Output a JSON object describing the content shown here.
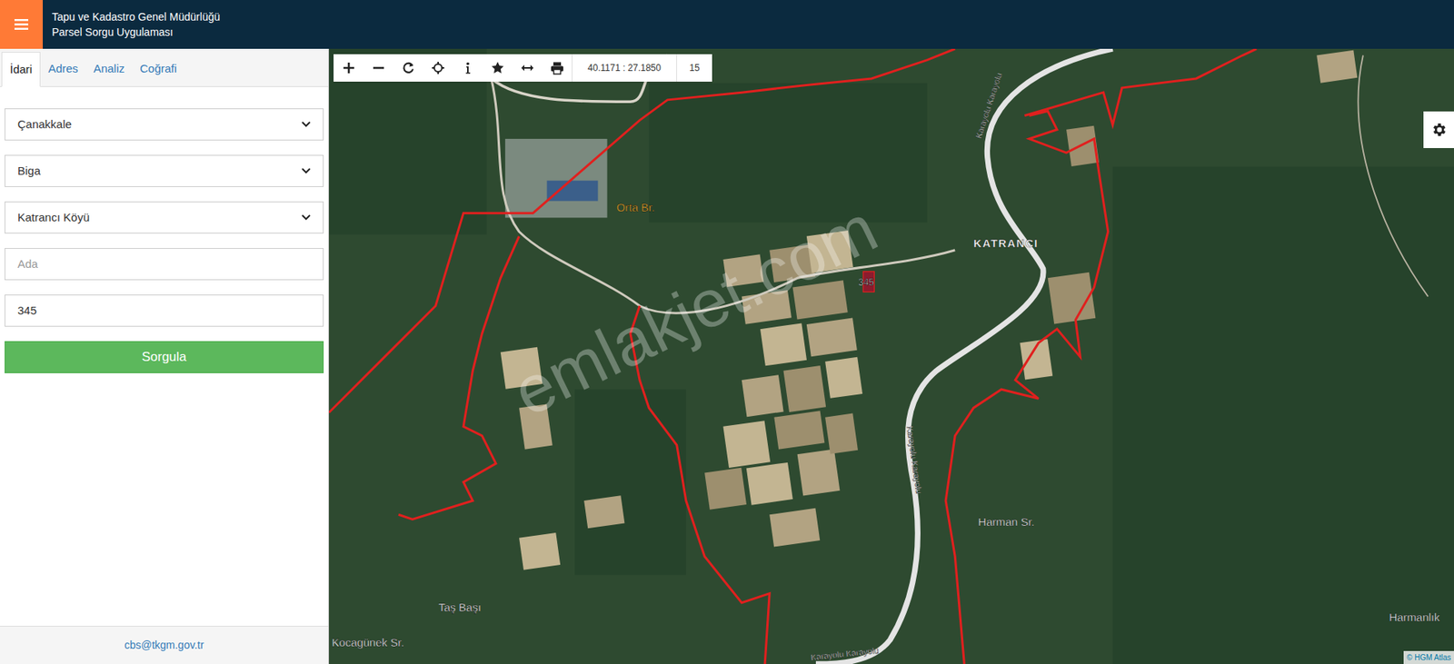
{
  "header": {
    "title_line1": "Tapu ve Kadastro Genel Müdürlüğü",
    "title_line2": "Parsel Sorgu Uygulaması"
  },
  "tabs": [
    {
      "label": "İdari",
      "selected": true
    },
    {
      "label": "Adres",
      "selected": false
    },
    {
      "label": "Analiz",
      "selected": false
    },
    {
      "label": "Coğrafi",
      "selected": false
    }
  ],
  "fields": [
    {
      "kind": "select",
      "value": "Çanakkale"
    },
    {
      "kind": "select",
      "value": "Biga"
    },
    {
      "kind": "select",
      "value": "Katrancı Köyü"
    },
    {
      "kind": "input",
      "placeholder": "Ada",
      "value": ""
    },
    {
      "kind": "input",
      "value": "345"
    }
  ],
  "query_button": "Sorgula",
  "footer": "cbs@tkgm.gov.tr",
  "toolbar": {
    "coordinates": "40.1171 : 27.1850",
    "zoom": "15"
  },
  "map": {
    "labels": [
      {
        "text": "Orta Br.",
        "kind": "place"
      },
      {
        "text": "KATRANCI",
        "kind": "village"
      },
      {
        "text": "Harman Sr.",
        "kind": "place"
      },
      {
        "text": "Taş Başı",
        "kind": "place"
      },
      {
        "text": "Kocagünek Sr.",
        "kind": "place"
      },
      {
        "text": "Harmanlık",
        "kind": "place"
      },
      {
        "text": "Karayolu Karayolu",
        "kind": "road"
      },
      {
        "text": "Karayolu Karayolu",
        "kind": "road"
      },
      {
        "text": "Karayolu Karayolu",
        "kind": "road"
      }
    ],
    "parcel_label": "345",
    "watermark": "emlakjet.com",
    "attribution": "© HGM Atlas"
  }
}
